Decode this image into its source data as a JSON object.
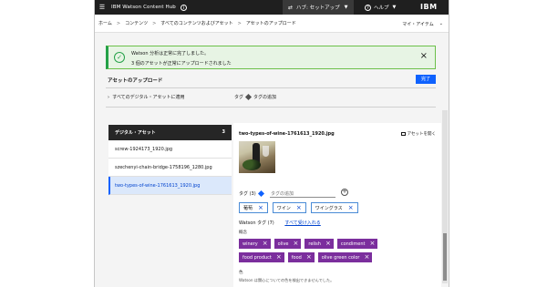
{
  "topbar": {
    "menu_icon": "hamburger-icon",
    "app_title": "IBM Watson Content Hub",
    "info_label": "i",
    "hub_label": "ハブ: セットアップ",
    "help_label": "ヘルプ",
    "help_icon_text": "?",
    "ibm_logo": "IBM"
  },
  "breadcrumb": {
    "items": [
      "ホーム",
      "コンテンツ",
      "すべてのコンテンツおよびアセット",
      "アセットのアップロード"
    ],
    "my_items": "マイ・アイテム"
  },
  "notification": {
    "line1": "Watson 分析は正常に完了しました。",
    "line2": "3 個のアセットが正常にアップロードされました",
    "close": "×"
  },
  "upload": {
    "title": "アセットのアップロード",
    "done_label": "完了",
    "apply_all": "すべてのデジタル・アセットに適用",
    "tag_label": "タグ",
    "add_tag": "タグの追加"
  },
  "asset_list": {
    "header": "デジタル・アセット",
    "count": "3",
    "items": [
      {
        "name": "screw-1924173_1920.jpg",
        "selected": false
      },
      {
        "name": "szechenyi-chain-bridge-1758196_1280.jpg",
        "selected": false
      },
      {
        "name": "two-types-of-wine-1761613_1920.jpg",
        "selected": true
      }
    ]
  },
  "detail": {
    "filename": "two-types-of-wine-1761613_1920.jpg",
    "open_asset": "アセットを開く",
    "tags_label": "タグ (3)",
    "tag_input_placeholder": "タグの追加",
    "user_tags": [
      "葡萄",
      "ワイン",
      "ワイングラス"
    ],
    "watson_tags_label": "Watson タグ (7)",
    "accept_all": "すべて受け入れる",
    "concept_label": "概念",
    "watson_tags": [
      "winery",
      "olive",
      "relish",
      "condiment",
      "food product",
      "food",
      "olive green color"
    ],
    "color_label": "色",
    "color_text": "Watson は関心についての色を検出できませんでした。"
  },
  "colors": {
    "topbar": "#1f1f1f",
    "primary": "#0f62fe",
    "success": "#24a148",
    "watson_tag": "#7b2e9d"
  }
}
